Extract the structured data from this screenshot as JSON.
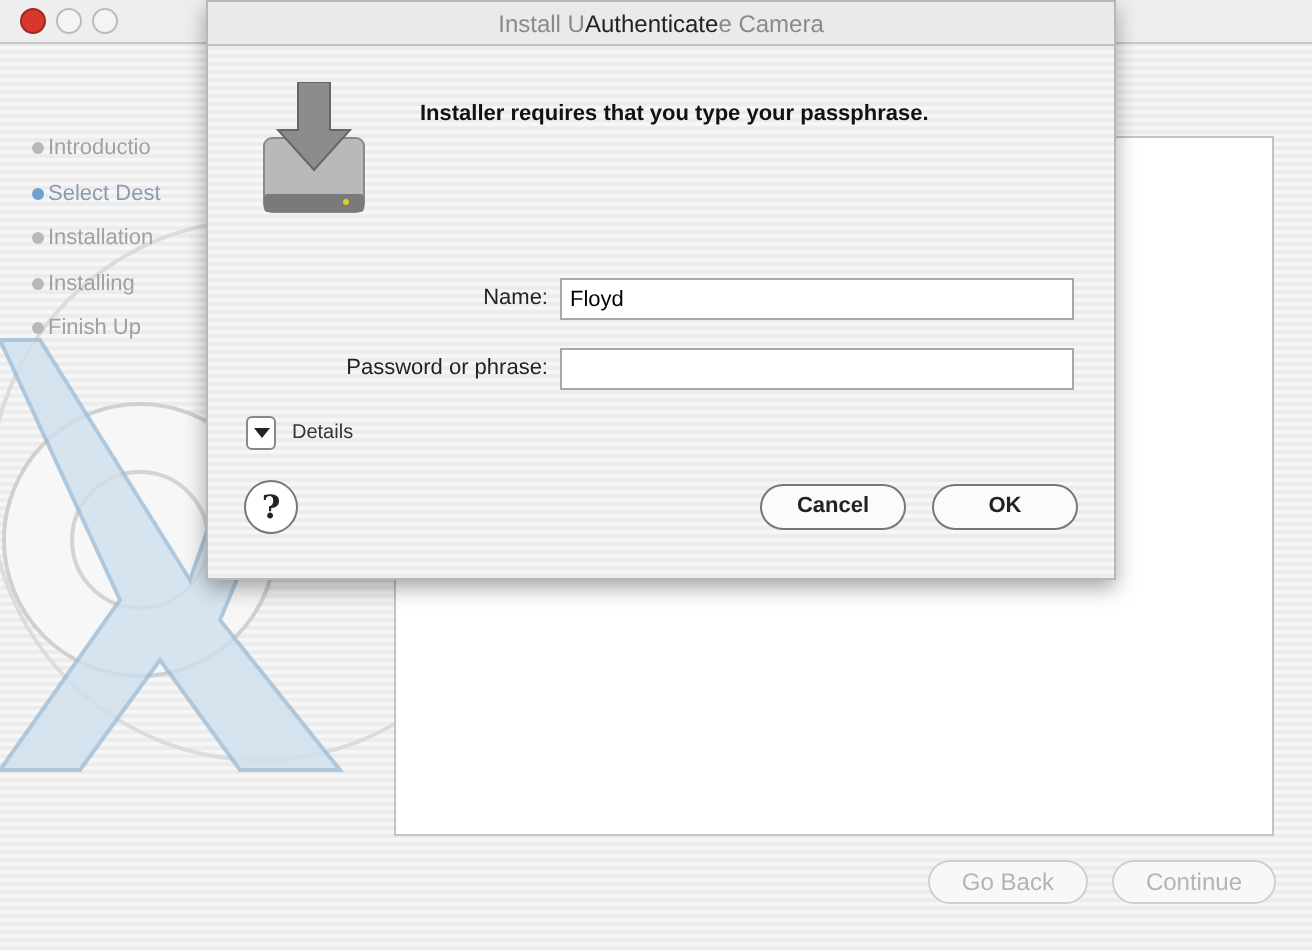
{
  "background_window": {
    "title_fragments": [
      "Install U",
      "e Camera"
    ],
    "steps": [
      {
        "label": "Introductio",
        "selected": false
      },
      {
        "label": "Select Dest",
        "selected": true
      },
      {
        "label": "Installation",
        "selected": false
      },
      {
        "label": "Installing",
        "selected": false
      },
      {
        "label": "Finish Up",
        "selected": false
      }
    ],
    "buttons": [
      {
        "label": "Go Back",
        "disabled": true
      },
      {
        "label": "Continue",
        "disabled": true
      }
    ]
  },
  "dialog": {
    "title": "Authenticate",
    "message": "Installer requires that you type your passphrase.",
    "fields": [
      {
        "label": "Name:",
        "value": "Floyd"
      },
      {
        "label": "Password or phrase:"
      }
    ],
    "details": {
      "label": "Details",
      "expanded": false
    },
    "help": "?",
    "buttons": [
      {
        "label": "Cancel",
        "default": false
      },
      {
        "label": "OK",
        "default": false
      }
    ]
  }
}
